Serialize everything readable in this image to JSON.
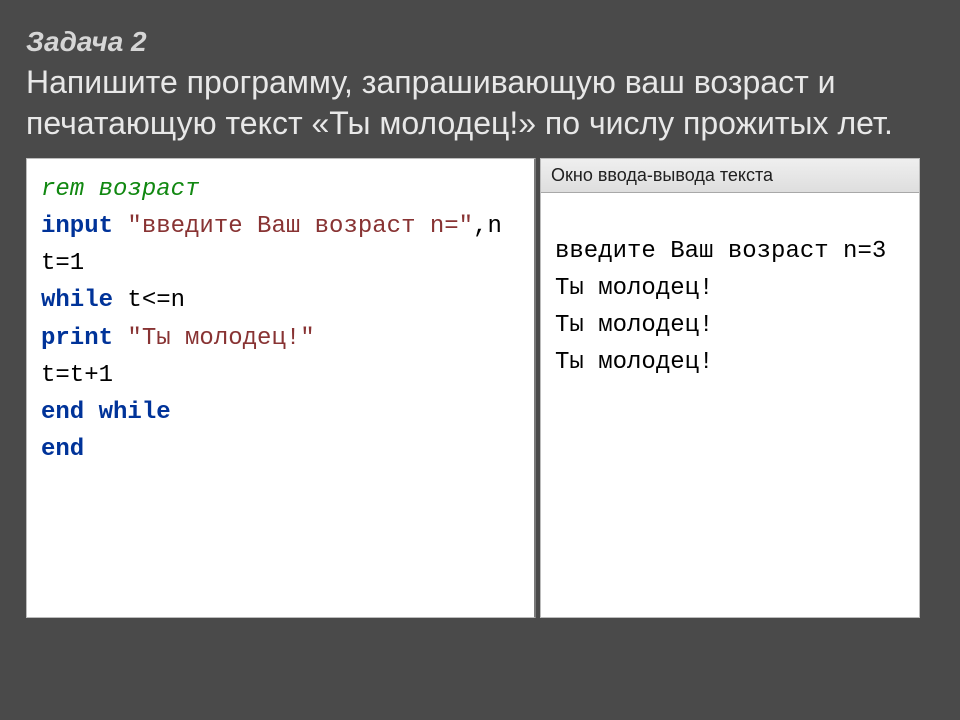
{
  "title": "Задача 2",
  "description": "Напишите программу, запрашивающую ваш возраст и печатающую текст «Ты молодец!» по числу прожитых лет.",
  "code": {
    "l1_comment": "rem возраст",
    "l2_kw": "input",
    "l2_str": "\"введите Ваш возраст n=\"",
    "l2_tail": ",n",
    "l3": "t=1",
    "l4_kw": "while",
    "l4_cond": " t<=n",
    "l5_kw": "print",
    "l5_str": "\"Ты молодец!\"",
    "l6": "t=t+1",
    "l7": "end while",
    "l8": "end"
  },
  "io": {
    "header": "Окно ввода-вывода текста",
    "lines": {
      "o1": "введите Ваш возраст n=3",
      "o2": "Ты молодец!",
      "o3": "Ты молодец!",
      "o4": "Ты молодец!"
    }
  }
}
